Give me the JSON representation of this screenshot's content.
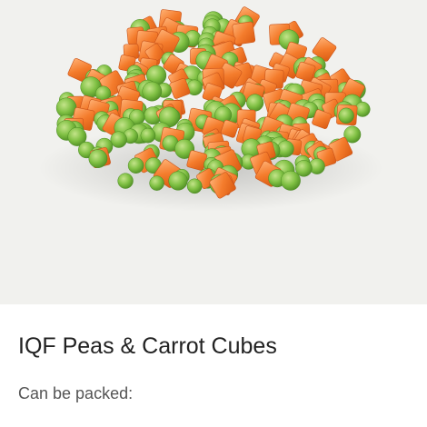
{
  "product": {
    "title": "IQF Peas & Carrot Cubes",
    "packing_label": "Can be packed:"
  },
  "image": {
    "subject": "peas-and-carrot-cubes-photo",
    "background_color": "#f1f1ee",
    "pea_color": "#7bbf3f",
    "carrot_color": "#f07a2a"
  }
}
